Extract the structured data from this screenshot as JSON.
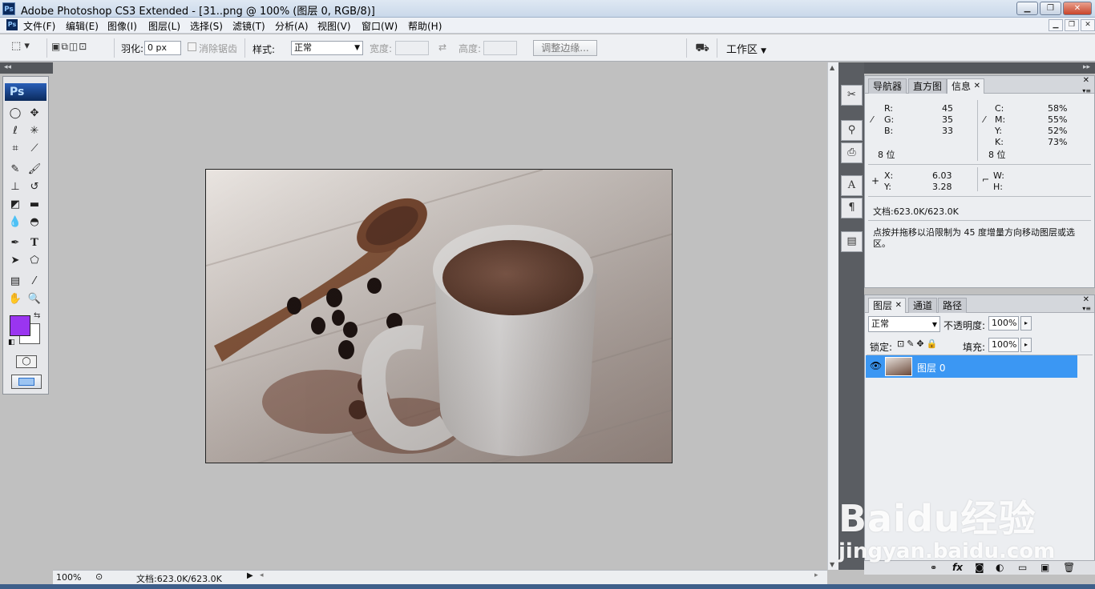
{
  "window": {
    "app_icon": "Ps",
    "title": "Adobe Photoshop CS3 Extended - [31..png @ 100% (图层 0, RGB/8)]",
    "controls": [
      "minimize",
      "restore",
      "close"
    ]
  },
  "menu": [
    "文件(F)",
    "编辑(E)",
    "图像(I)",
    "图层(L)",
    "选择(S)",
    "滤镜(T)",
    "分析(A)",
    "视图(V)",
    "窗口(W)",
    "帮助(H)"
  ],
  "options_bar": {
    "feather_label": "羽化:",
    "feather_value": "0 px",
    "antialias_label": "消除锯齿",
    "style_label": "样式:",
    "style_value": "正常",
    "width_label": "宽度:",
    "height_label": "高度:",
    "refine_edge_label": "调整边缘...",
    "workspace_label": "工作区"
  },
  "toolbox": {
    "logo": "Ps",
    "foreground_color": "#9a35f0",
    "background_color": "#ffffff"
  },
  "status": {
    "zoom": "100%",
    "doc_size": "文档:623.0K/623.0K"
  },
  "info_panel": {
    "tabs": [
      "导航器",
      "直方图",
      "信息"
    ],
    "active_tab": "信息",
    "rgb": {
      "R": "45",
      "G": "35",
      "B": "33"
    },
    "cmyk": {
      "C": "58%",
      "M": "55%",
      "Y": "52%",
      "K": "73%"
    },
    "bits_left": "8 位",
    "bits_right": "8 位",
    "x_label": "X:",
    "x_value": "6.03",
    "y_label": "Y:",
    "y_value": "3.28",
    "w_label": "W:",
    "h_label": "H:",
    "doc_size": "文档:623.0K/623.0K",
    "hint": "点按并拖移以沿限制为 45 度增量方向移动图层或选区。"
  },
  "layers_panel": {
    "tabs": [
      "图层",
      "通道",
      "路径"
    ],
    "active_tab": "图层",
    "blend_mode": "正常",
    "opacity_label": "不透明度:",
    "opacity_value": "100%",
    "lock_label": "锁定:",
    "fill_label": "填充:",
    "fill_value": "100%",
    "layers": [
      {
        "name": "图层 0",
        "visible": true,
        "selected": true
      }
    ],
    "footer_icons": [
      "link-icon",
      "fx-icon",
      "mask-icon",
      "adjustment-icon",
      "group-icon",
      "new-layer-icon",
      "trash-icon"
    ]
  },
  "watermark": {
    "brand": "Baidu经验",
    "url": "jingyan.baidu.com"
  }
}
